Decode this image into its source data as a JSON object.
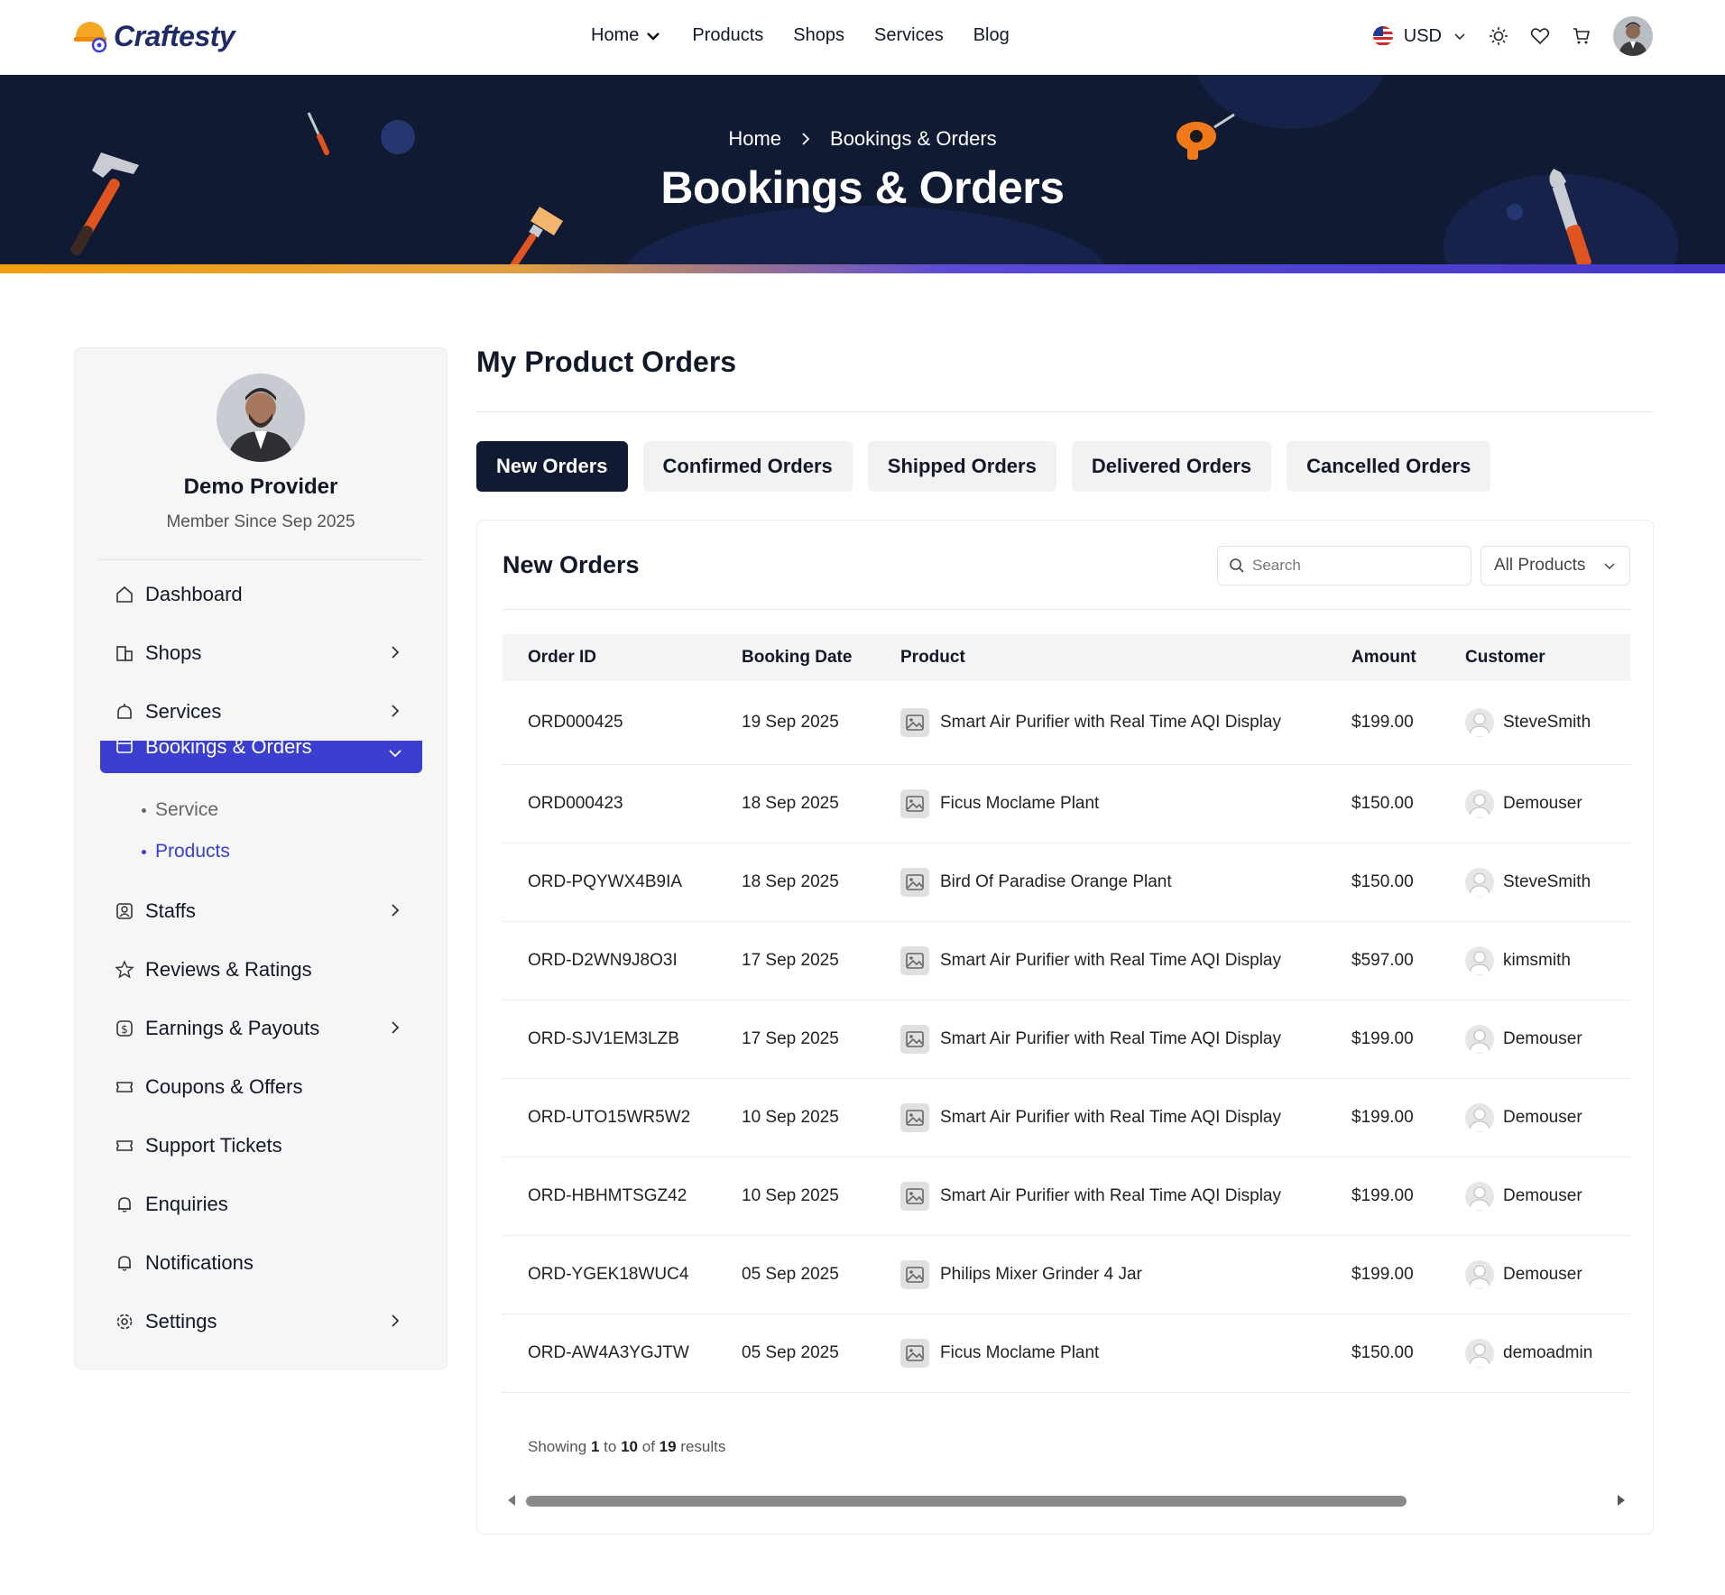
{
  "brand": {
    "name": "Craftesty"
  },
  "nav": {
    "items": [
      {
        "label": "Home",
        "has_dropdown": true
      },
      {
        "label": "Products"
      },
      {
        "label": "Shops"
      },
      {
        "label": "Services"
      },
      {
        "label": "Blog"
      }
    ]
  },
  "header": {
    "currency": "USD",
    "icons": [
      "sun-icon",
      "heart-icon",
      "cart-icon"
    ]
  },
  "banner": {
    "breadcrumb_home": "Home",
    "breadcrumb_current": "Bookings & Orders",
    "title": "Bookings & Orders"
  },
  "profile": {
    "name": "Demo Provider",
    "since": "Member Since Sep 2025"
  },
  "sidebar": {
    "items": [
      {
        "label": "Dashboard",
        "icon": "home-icon",
        "chevron": false
      },
      {
        "label": "Shops",
        "icon": "shop-icon",
        "chevron": true
      },
      {
        "label": "Services",
        "icon": "services-icon",
        "chevron": true
      },
      {
        "label": "Bookings & Orders",
        "icon": "calendar-icon",
        "chevron": true,
        "active": true
      },
      {
        "label": "Staffs",
        "icon": "staff-icon",
        "chevron": true
      },
      {
        "label": "Reviews & Ratings",
        "icon": "star-icon",
        "chevron": false
      },
      {
        "label": "Earnings & Payouts",
        "icon": "dollar-icon",
        "chevron": true
      },
      {
        "label": "Coupons & Offers",
        "icon": "ticket-icon",
        "chevron": false
      },
      {
        "label": "Support Tickets",
        "icon": "ticket-icon",
        "chevron": false
      },
      {
        "label": "Enquiries",
        "icon": "bell-icon",
        "chevron": false
      },
      {
        "label": "Notifications",
        "icon": "bell-icon",
        "chevron": false
      },
      {
        "label": "Settings",
        "icon": "gear-icon",
        "chevron": true
      }
    ],
    "submenu": [
      {
        "label": "Service"
      },
      {
        "label": "Products",
        "current": true
      }
    ]
  },
  "main": {
    "title": "My Product Orders",
    "tabs": [
      {
        "label": "New Orders",
        "active": true
      },
      {
        "label": "Confirmed Orders"
      },
      {
        "label": "Shipped Orders"
      },
      {
        "label": "Delivered Orders"
      },
      {
        "label": "Cancelled Orders"
      }
    ],
    "card_title": "New Orders",
    "search_placeholder": "Search",
    "filter_label": "All Products",
    "columns": [
      "Order ID",
      "Booking Date",
      "Product",
      "Amount",
      "Customer"
    ],
    "rows": [
      {
        "id": "ORD000425",
        "date": "19 Sep 2025",
        "product": "Smart Air Purifier with Real Time AQI Display",
        "amount": "$199.00",
        "customer": "SteveSmith"
      },
      {
        "id": "ORD000423",
        "date": "18 Sep 2025",
        "product": "Ficus Moclame Plant",
        "amount": "$150.00",
        "customer": "Demouser"
      },
      {
        "id": "ORD-PQYWX4B9IA",
        "date": "18 Sep 2025",
        "product": "Bird Of Paradise Orange Plant",
        "amount": "$150.00",
        "customer": "SteveSmith"
      },
      {
        "id": "ORD-D2WN9J8O3I",
        "date": "17 Sep 2025",
        "product": "Smart Air Purifier with Real Time AQI Display",
        "amount": "$597.00",
        "customer": "kimsmith"
      },
      {
        "id": "ORD-SJV1EM3LZB",
        "date": "17 Sep 2025",
        "product": "Smart Air Purifier with Real Time AQI Display",
        "amount": "$199.00",
        "customer": "Demouser"
      },
      {
        "id": "ORD-UTO15WR5W2",
        "date": "10 Sep 2025",
        "product": "Smart Air Purifier with Real Time AQI Display",
        "amount": "$199.00",
        "customer": "Demouser"
      },
      {
        "id": "ORD-HBHMTSGZ42",
        "date": "10 Sep 2025",
        "product": "Smart Air Purifier with Real Time AQI Display",
        "amount": "$199.00",
        "customer": "Demouser"
      },
      {
        "id": "ORD-YGEK18WUC4",
        "date": "05 Sep 2025",
        "product": "Philips Mixer Grinder 4 Jar",
        "amount": "$199.00",
        "customer": "Demouser"
      },
      {
        "id": "ORD-AW4A3YGJTW",
        "date": "05 Sep 2025",
        "product": "Ficus Moclame Plant",
        "amount": "$150.00",
        "customer": "demoadmin"
      }
    ],
    "pagination": {
      "prefix": "Showing",
      "from": "1",
      "to_word": "to",
      "to": "10",
      "of_word": "of",
      "total": "19",
      "suffix": "results"
    }
  },
  "colors": {
    "accent": "#3a3fd0",
    "dark": "#111a33",
    "brand_orange": "#f59e0b"
  }
}
